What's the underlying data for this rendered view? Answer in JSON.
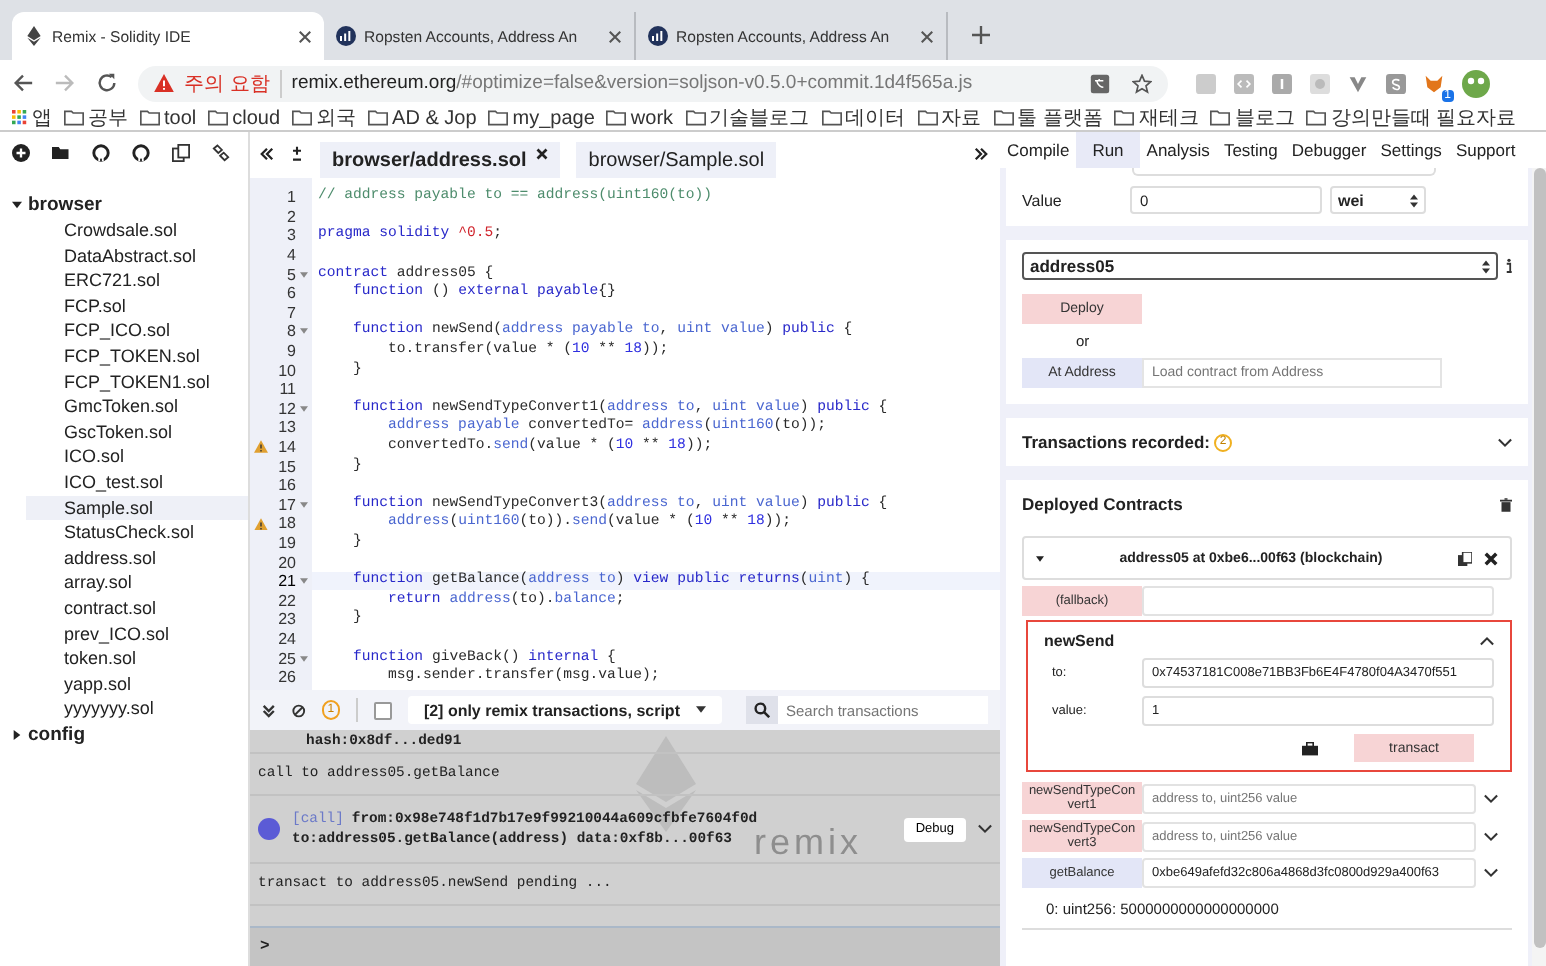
{
  "browser": {
    "tabs": [
      {
        "title": "Remix - Solidity IDE",
        "selected": true,
        "kind": "ethereum"
      },
      {
        "title": "Ropsten Accounts, Address An",
        "selected": false,
        "kind": "etherscan"
      },
      {
        "title": "Ropsten Accounts, Address An",
        "selected": false,
        "kind": "etherscan"
      }
    ],
    "security_label": "주의 요함",
    "url_domain": "remix.ethereum.org",
    "url_rest": "/#optimize=false&version=soljson-v0.5.0+commit.1d4f565a.js",
    "extension_badge": "1",
    "bookmarks": [
      {
        "label": "앱",
        "kind": "apps"
      },
      {
        "label": "공부",
        "kind": "folder"
      },
      {
        "label": "tool",
        "kind": "folder"
      },
      {
        "label": "cloud",
        "kind": "folder"
      },
      {
        "label": "외국",
        "kind": "folder"
      },
      {
        "label": "AD & Jop",
        "kind": "folder"
      },
      {
        "label": "my_page",
        "kind": "folder"
      },
      {
        "label": "work",
        "kind": "folder"
      },
      {
        "label": "기술블로그",
        "kind": "folder"
      },
      {
        "label": "데이터",
        "kind": "folder"
      },
      {
        "label": "자료",
        "kind": "folder"
      },
      {
        "label": "툴 플랫폼",
        "kind": "folder"
      },
      {
        "label": "재테크",
        "kind": "folder"
      },
      {
        "label": "블로그",
        "kind": "folder"
      },
      {
        "label": "강의만들때 필요자료",
        "kind": "folder"
      }
    ]
  },
  "file_explorer": {
    "tree": [
      {
        "name": "browser",
        "expanded": true,
        "children": [
          {
            "name": "Crowdsale.sol",
            "selected": false
          },
          {
            "name": "DataAbstract.sol",
            "selected": false
          },
          {
            "name": "ERC721.sol",
            "selected": false
          },
          {
            "name": "FCP.sol",
            "selected": false
          },
          {
            "name": "FCP_ICO.sol",
            "selected": false
          },
          {
            "name": "FCP_TOKEN.sol",
            "selected": false
          },
          {
            "name": "FCP_TOKEN1.sol",
            "selected": false
          },
          {
            "name": "GmcToken.sol",
            "selected": false
          },
          {
            "name": "GscToken.sol",
            "selected": false
          },
          {
            "name": "ICO.sol",
            "selected": false
          },
          {
            "name": "ICO_test.sol",
            "selected": false
          },
          {
            "name": "Sample.sol",
            "selected": true
          },
          {
            "name": "StatusCheck.sol",
            "selected": false
          },
          {
            "name": "address.sol",
            "selected": false
          },
          {
            "name": "array.sol",
            "selected": false
          },
          {
            "name": "contract.sol",
            "selected": false
          },
          {
            "name": "prev_ICO.sol",
            "selected": false
          },
          {
            "name": "token.sol",
            "selected": false
          },
          {
            "name": "yapp.sol",
            "selected": false
          },
          {
            "name": "yyyyyyy.sol",
            "selected": false
          }
        ]
      },
      {
        "name": "config",
        "expanded": false
      }
    ]
  },
  "editor": {
    "tabs": [
      {
        "label": "browser/address.sol",
        "selected": true
      },
      {
        "label": "browser/Sample.sol",
        "selected": false
      }
    ],
    "lines": [
      {
        "number": "1",
        "fold": false,
        "warning": false,
        "active": false,
        "tokens": [
          {
            "kind": "comment",
            "text": "// address payable to == address(uint160(to))"
          }
        ]
      },
      {
        "number": "2",
        "fold": false,
        "warning": false,
        "active": false
      },
      {
        "number": "3",
        "fold": false,
        "warning": false,
        "active": false,
        "tokens": [
          {
            "kind": "keyword",
            "text": "pragma solidity "
          },
          {
            "kind": "version",
            "text": "^0.5"
          },
          {
            "kind": "plain",
            "text": ";"
          }
        ]
      },
      {
        "number": "4",
        "fold": false,
        "warning": false,
        "active": false
      },
      {
        "number": "5",
        "fold": true,
        "warning": false,
        "active": false,
        "tokens": [
          {
            "kind": "keyword",
            "text": "contract "
          },
          {
            "kind": "plain",
            "text": "address05 {"
          }
        ]
      },
      {
        "number": "6",
        "fold": false,
        "warning": false,
        "active": false,
        "tokens": [
          {
            "kind": "keyword",
            "text": "    function "
          },
          {
            "kind": "plain",
            "text": "() "
          },
          {
            "kind": "keyword",
            "text": "external payable"
          },
          {
            "kind": "plain",
            "text": "{}"
          }
        ]
      },
      {
        "number": "7",
        "fold": false,
        "warning": false,
        "active": false
      },
      {
        "number": "8",
        "fold": true,
        "warning": false,
        "active": false,
        "tokens": [
          {
            "kind": "keyword",
            "text": "    function "
          },
          {
            "kind": "plain",
            "text": "newSend("
          },
          {
            "kind": "type",
            "text": "address payable to"
          },
          {
            "kind": "plain",
            "text": ", "
          },
          {
            "kind": "type",
            "text": "uint value"
          },
          {
            "kind": "plain",
            "text": ") "
          },
          {
            "kind": "keyword",
            "text": "public"
          },
          {
            "kind": "plain",
            "text": " {"
          }
        ]
      },
      {
        "number": "9",
        "fold": false,
        "warning": false,
        "active": false,
        "tokens": [
          {
            "kind": "plain",
            "text": "        to.transfer(value * ("
          },
          {
            "kind": "number",
            "text": "10"
          },
          {
            "kind": "plain",
            "text": " ** "
          },
          {
            "kind": "number",
            "text": "18"
          },
          {
            "kind": "plain",
            "text": "));"
          }
        ]
      },
      {
        "number": "10",
        "fold": false,
        "warning": false,
        "active": false,
        "tokens": [
          {
            "kind": "plain",
            "text": "    }"
          }
        ]
      },
      {
        "number": "11",
        "fold": false,
        "warning": false,
        "active": false
      },
      {
        "number": "12",
        "fold": true,
        "warning": false,
        "active": false,
        "tokens": [
          {
            "kind": "keyword",
            "text": "    function "
          },
          {
            "kind": "plain",
            "text": "newSendTypeConvert1("
          },
          {
            "kind": "type",
            "text": "address to"
          },
          {
            "kind": "plain",
            "text": ", "
          },
          {
            "kind": "type",
            "text": "uint value"
          },
          {
            "kind": "plain",
            "text": ") "
          },
          {
            "kind": "keyword",
            "text": "public"
          },
          {
            "kind": "plain",
            "text": " {"
          }
        ]
      },
      {
        "number": "13",
        "fold": false,
        "warning": false,
        "active": false,
        "tokens": [
          {
            "kind": "type",
            "text": "        address payable"
          },
          {
            "kind": "plain",
            "text": " convertedTo= "
          },
          {
            "kind": "type",
            "text": "address"
          },
          {
            "kind": "plain",
            "text": "("
          },
          {
            "kind": "type",
            "text": "uint160"
          },
          {
            "kind": "plain",
            "text": "(to));"
          }
        ]
      },
      {
        "number": "14",
        "fold": false,
        "warning": true,
        "active": false,
        "tokens": [
          {
            "kind": "plain",
            "text": "        convertedTo."
          },
          {
            "kind": "type",
            "text": "send"
          },
          {
            "kind": "plain",
            "text": "(value * ("
          },
          {
            "kind": "number",
            "text": "10"
          },
          {
            "kind": "plain",
            "text": " ** "
          },
          {
            "kind": "number",
            "text": "18"
          },
          {
            "kind": "plain",
            "text": "));"
          }
        ]
      },
      {
        "number": "15",
        "fold": false,
        "warning": false,
        "active": false,
        "tokens": [
          {
            "kind": "plain",
            "text": "    }"
          }
        ]
      },
      {
        "number": "16",
        "fold": false,
        "warning": false,
        "active": false
      },
      {
        "number": "17",
        "fold": true,
        "warning": false,
        "active": false,
        "tokens": [
          {
            "kind": "keyword",
            "text": "    function "
          },
          {
            "kind": "plain",
            "text": "newSendTypeConvert3("
          },
          {
            "kind": "type",
            "text": "address to"
          },
          {
            "kind": "plain",
            "text": ", "
          },
          {
            "kind": "type",
            "text": "uint value"
          },
          {
            "kind": "plain",
            "text": ") "
          },
          {
            "kind": "keyword",
            "text": "public"
          },
          {
            "kind": "plain",
            "text": " {"
          }
        ]
      },
      {
        "number": "18",
        "fold": false,
        "warning": true,
        "active": false,
        "tokens": [
          {
            "kind": "type",
            "text": "        address"
          },
          {
            "kind": "plain",
            "text": "("
          },
          {
            "kind": "type",
            "text": "uint160"
          },
          {
            "kind": "plain",
            "text": "(to))."
          },
          {
            "kind": "type",
            "text": "send"
          },
          {
            "kind": "plain",
            "text": "(value * ("
          },
          {
            "kind": "number",
            "text": "10"
          },
          {
            "kind": "plain",
            "text": " ** "
          },
          {
            "kind": "number",
            "text": "18"
          },
          {
            "kind": "plain",
            "text": "));"
          }
        ]
      },
      {
        "number": "19",
        "fold": false,
        "warning": false,
        "active": false,
        "tokens": [
          {
            "kind": "plain",
            "text": "    }"
          }
        ]
      },
      {
        "number": "20",
        "fold": false,
        "warning": false,
        "active": false
      },
      {
        "number": "21",
        "fold": true,
        "warning": false,
        "active": true,
        "tokens": [
          {
            "kind": "keyword",
            "text": "    function "
          },
          {
            "kind": "plain",
            "text": "getBalance("
          },
          {
            "kind": "type",
            "text": "address to"
          },
          {
            "kind": "plain",
            "text": ") "
          },
          {
            "kind": "keyword",
            "text": "view public returns"
          },
          {
            "kind": "plain",
            "text": "("
          },
          {
            "kind": "type",
            "text": "uint"
          },
          {
            "kind": "plain",
            "text": ") {"
          }
        ]
      },
      {
        "number": "22",
        "fold": false,
        "warning": false,
        "active": false,
        "tokens": [
          {
            "kind": "keyword",
            "text": "        return "
          },
          {
            "kind": "type",
            "text": "address"
          },
          {
            "kind": "plain",
            "text": "(to)."
          },
          {
            "kind": "type",
            "text": "balance"
          },
          {
            "kind": "plain",
            "text": ";"
          }
        ]
      },
      {
        "number": "23",
        "fold": false,
        "warning": false,
        "active": false,
        "tokens": [
          {
            "kind": "plain",
            "text": "    }"
          }
        ]
      },
      {
        "number": "24",
        "fold": false,
        "warning": false,
        "active": false
      },
      {
        "number": "25",
        "fold": true,
        "warning": false,
        "active": false,
        "tokens": [
          {
            "kind": "keyword",
            "text": "    function "
          },
          {
            "kind": "plain",
            "text": "giveBack() "
          },
          {
            "kind": "keyword",
            "text": "internal"
          },
          {
            "kind": "plain",
            "text": " {"
          }
        ]
      },
      {
        "number": "26",
        "fold": false,
        "warning": false,
        "active": false,
        "tokens": [
          {
            "kind": "plain",
            "text": "        msg.sender.transfer(msg.value);"
          }
        ]
      }
    ]
  },
  "terminal": {
    "pending_count": "1",
    "listen_checked": false,
    "filter": "[2] only remix transactions, script",
    "search_placeholder": "Search transactions",
    "watermark": "remix",
    "prompt": ">",
    "entries": [
      {
        "kind": "detail",
        "text": "hash:0x8df...ded91"
      },
      {
        "kind": "log",
        "text": "call to address05.getBalance"
      },
      {
        "kind": "call",
        "tag": "[call]",
        "line1": "from:0x98e748f1d7b17e9f99210044a609cfbfe7604f0d",
        "line2": "to:address05.getBalance(address) data:0xf8b...00f63",
        "button": "Debug"
      },
      {
        "kind": "log",
        "text": "transact to address05.newSend pending ..."
      }
    ]
  },
  "run_panel": {
    "tabs": [
      {
        "label": "Compile",
        "selected": false
      },
      {
        "label": "Run",
        "selected": true
      },
      {
        "label": "Analysis",
        "selected": false
      },
      {
        "label": "Testing",
        "selected": false
      },
      {
        "label": "Debugger",
        "selected": false
      },
      {
        "label": "Settings",
        "selected": false
      },
      {
        "label": "Support",
        "selected": false
      }
    ],
    "value_label": "Value",
    "value": "0",
    "unit": "wei",
    "contract": "address05",
    "deploy": "Deploy",
    "or": "or",
    "at_address": "At Address",
    "at_address_placeholder": "Load contract from Address",
    "transactions_label": "Transactions recorded:",
    "transactions_count": "2",
    "deployed_title": "Deployed Contracts",
    "instance": {
      "title": "address05 at 0xbe6...00f63 (blockchain)",
      "expanded": true,
      "functions": [
        {
          "name": "(fallback)",
          "kind": "transact",
          "expanded": false
        },
        {
          "name": "newSend",
          "kind": "transact",
          "expanded": true,
          "params": [
            {
              "label": "to:",
              "value": "0x74537181C008e71BB3Fb6E4F4780f04A3470f551"
            },
            {
              "label": "value:",
              "value": "1"
            }
          ],
          "button": "transact"
        },
        {
          "name": "newSendTypeConvert1",
          "kind": "transact",
          "expanded": false,
          "placeholder": "address to, uint256 value"
        },
        {
          "name": "newSendTypeConvert3",
          "kind": "transact",
          "expanded": false,
          "placeholder": "address to, uint256 value"
        },
        {
          "name": "getBalance",
          "kind": "call",
          "expanded": false,
          "value": "0xbe649afefd32c806a4868d3fc0800d929a400f63",
          "result": "0: uint256: 5000000000000000000"
        }
      ]
    }
  }
}
